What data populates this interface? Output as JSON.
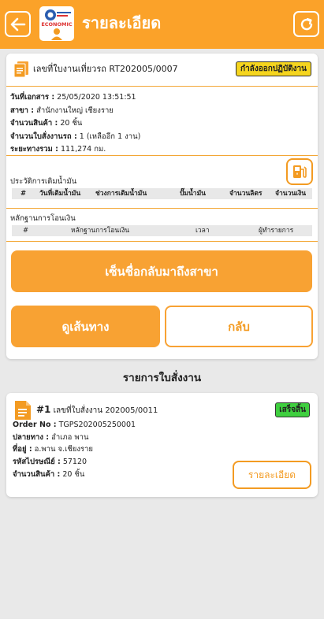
{
  "header": {
    "title": "รายละเอียด",
    "logo_text": "ECONOMIC"
  },
  "summary": {
    "doc_no_label": "เลขที่ใบงานเที่ยวรถ",
    "doc_no": "RT202005/0007",
    "status": "กำลังออกปฏิบัติงาน",
    "fields": [
      {
        "label": "วันที่เอกสาร :",
        "value": " 25/05/2020 13:51:51"
      },
      {
        "label": "สาขา :",
        "value": " สำนักงานใหญ่ เชียงราย"
      },
      {
        "label": "จำนวนสินค้า :",
        "value": " 20 ชิ้น"
      },
      {
        "label": "จำนวนใบสั่งงานรถ :",
        "value": " 1 (เหลืออีก 1 งาน)"
      },
      {
        "label": "ระยะทางรวม :",
        "value": " 111,274 กม."
      }
    ]
  },
  "fuel_history": {
    "title": "ประวัติการเติมน้ำมัน",
    "columns": [
      "#",
      "วันที่เติมน้ำมัน",
      "ช่วงการเติมน้ำมัน",
      "ปั๊มน้ำมัน",
      "จำนวนลิตร",
      "จำนวนเงิน"
    ]
  },
  "transfer": {
    "title": "หลักฐานการโอนเงิน",
    "columns": [
      "#",
      "หลักฐานการโอนเงิน",
      "เวลา",
      "ผู้ทำรายการ"
    ]
  },
  "buttons": {
    "checkin": "เซ็นชื่อกลับมาถึงสาขา",
    "route": "ดูเส้นทาง",
    "back": "กลับ"
  },
  "order_list": {
    "title": "รายการใบสั่งงาน",
    "items": [
      {
        "num": "#1",
        "order_label": "เลขที่ใบสั่งงาน",
        "order_no": "202005/0011",
        "status": "เสร็จสิ้น",
        "fields": [
          {
            "label": "Order No :",
            "value": " TGPS202005250001"
          },
          {
            "label": "ปลายทาง :",
            "value": " อำเภอ พาน"
          },
          {
            "label": "ที่อยู่ :",
            "value": " อ.พาน จ.เชียงราย"
          },
          {
            "label": "รหัสไปรษณีย์ :",
            "value": " 57120"
          },
          {
            "label": "จำนวนสินค้า :",
            "value": " 20 ชิ้น"
          }
        ],
        "detail_label": "รายละเอียด"
      }
    ]
  },
  "colors": {
    "brand": "#fba229",
    "status_working": "#f5d51f",
    "status_done": "#3fcf3f"
  }
}
